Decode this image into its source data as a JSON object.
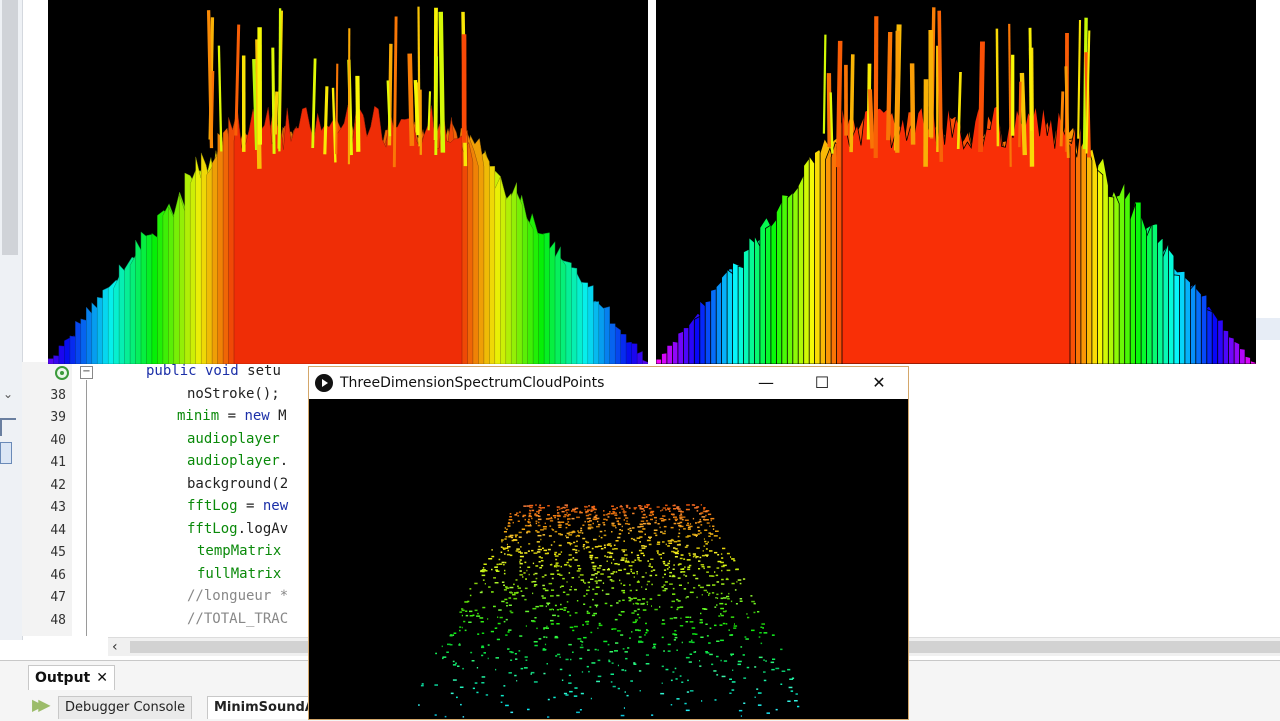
{
  "editor": {
    "lines": [
      {
        "num": "",
        "parts": [
          {
            "t": "public void ",
            "c": "kw"
          },
          {
            "t": "setu",
            "c": "plain"
          }
        ],
        "indent": 146
      },
      {
        "num": "38",
        "parts": [
          {
            "t": "noStroke();",
            "c": "plain"
          }
        ],
        "indent": 187
      },
      {
        "num": "39",
        "parts": [
          {
            "t": "minim",
            "c": "fld"
          },
          {
            "t": " = ",
            "c": "plain"
          },
          {
            "t": "new",
            "c": "kw"
          },
          {
            "t": " M",
            "c": "plain"
          }
        ],
        "indent": 177
      },
      {
        "num": "40",
        "parts": [
          {
            "t": "audioplayer",
            "c": "fld"
          }
        ],
        "indent": 187
      },
      {
        "num": "41",
        "parts": [
          {
            "t": "audioplayer",
            "c": "fld"
          },
          {
            "t": ".",
            "c": "plain"
          }
        ],
        "indent": 187
      },
      {
        "num": "42",
        "parts": [
          {
            "t": "background(2",
            "c": "plain"
          }
        ],
        "indent": 187
      },
      {
        "num": "43",
        "parts": [
          {
            "t": "fftLog",
            "c": "fld"
          },
          {
            "t": " = ",
            "c": "plain"
          },
          {
            "t": "new",
            "c": "kw"
          }
        ],
        "indent": 187
      },
      {
        "num": "44",
        "parts": [
          {
            "t": "fftLog",
            "c": "fld"
          },
          {
            "t": ".logAv",
            "c": "plain"
          }
        ],
        "indent": 187
      },
      {
        "num": "45",
        "parts": [
          {
            "t": "tempMatrix",
            "c": "fld"
          }
        ],
        "indent": 197
      },
      {
        "num": "46",
        "parts": [
          {
            "t": "fullMatrix",
            "c": "fld"
          }
        ],
        "indent": 197
      },
      {
        "num": "47",
        "parts": [
          {
            "t": "//longueur *",
            "c": "cmt"
          }
        ],
        "indent": 187
      },
      {
        "num": "48",
        "parts": [
          {
            "t": "//TOTAL_TRAC",
            "c": "cmt"
          }
        ],
        "indent": 187
      }
    ]
  },
  "output": {
    "tab_label": "Output",
    "close_glyph": "✕",
    "sub_tabs": [
      "Debugger Console",
      "MinimSoundA"
    ]
  },
  "sketch_window": {
    "title": "ThreeDimensionSpectrumCloudPoints",
    "minimize": "—",
    "maximize": "☐",
    "close": "✕"
  },
  "icons": {
    "breakpoint": "breakpoint-icon",
    "fold": "fold-toggle-icon",
    "processing_logo": "processing-logo-icon",
    "run": "run-icon"
  }
}
